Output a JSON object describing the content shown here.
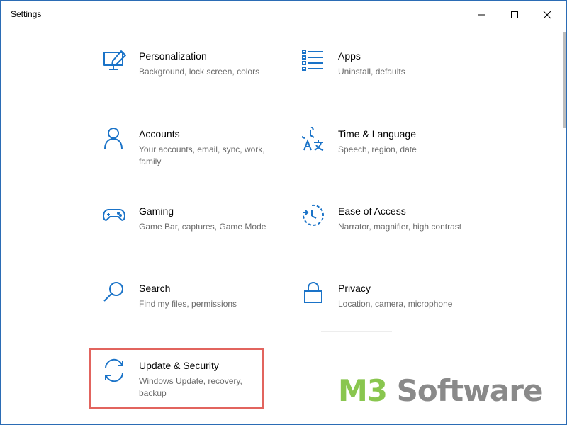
{
  "window": {
    "title": "Settings",
    "controls": {
      "minimize_icon": "minimize-icon",
      "maximize_icon": "maximize-icon",
      "close_icon": "close-icon"
    }
  },
  "settings": [
    {
      "name": "Personalization",
      "desc": "Background, lock screen, colors",
      "icon": "personalization-icon"
    },
    {
      "name": "Apps",
      "desc": "Uninstall, defaults",
      "icon": "apps-icon"
    },
    {
      "name": "Accounts",
      "desc": "Your accounts, email, sync, work, family",
      "icon": "accounts-icon"
    },
    {
      "name": "Time & Language",
      "desc": "Speech, region, date",
      "icon": "time-language-icon"
    },
    {
      "name": "Gaming",
      "desc": "Game Bar, captures, Game Mode",
      "icon": "gaming-icon"
    },
    {
      "name": "Ease of Access",
      "desc": "Narrator, magnifier, high contrast",
      "icon": "ease-of-access-icon"
    },
    {
      "name": "Search",
      "desc": "Find my files, permissions",
      "icon": "search-icon"
    },
    {
      "name": "Privacy",
      "desc": "Location, camera, microphone",
      "icon": "privacy-icon"
    },
    {
      "name": "Update & Security",
      "desc": "Windows Update, recovery, backup",
      "icon": "update-security-icon"
    }
  ],
  "highlighted_item": "Update & Security",
  "watermark": {
    "part1": "M3",
    "part2": " Software"
  },
  "colors": {
    "icon_accent": "#1a73c8",
    "highlight_border": "#e2645e",
    "watermark_green": "#89c64f",
    "watermark_gray": "#8a8a8a"
  }
}
